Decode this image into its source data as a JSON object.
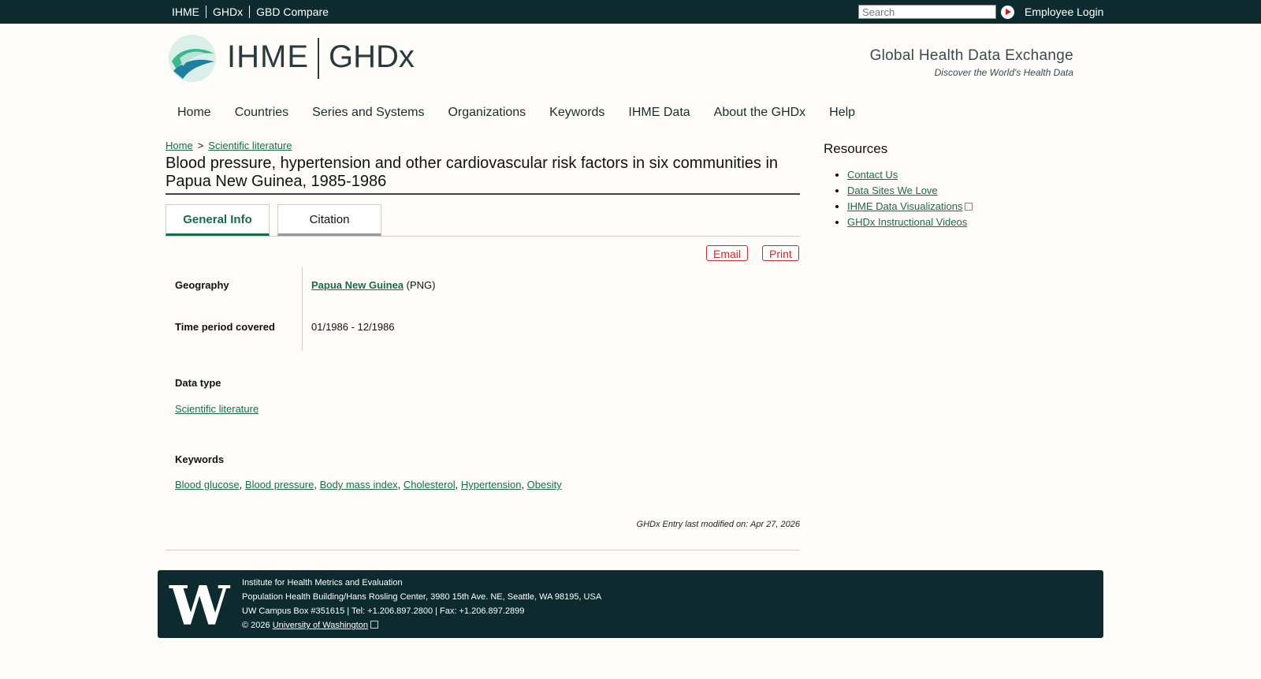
{
  "topbar": {
    "links": [
      "IHME",
      "GHDx",
      "GBD Compare"
    ],
    "search_placeholder": "Search",
    "employee_login": "Employee Login"
  },
  "header": {
    "logo_ihme": "IHME",
    "logo_ghdx": "GHDx",
    "tagline": "Global Health Data Exchange",
    "subtagline": "Discover the World's Health Data"
  },
  "nav": [
    "Home",
    "Countries",
    "Series and Systems",
    "Organizations",
    "Keywords",
    "IHME Data",
    "About the GHDx",
    "Help"
  ],
  "breadcrumb": {
    "home": "Home",
    "sep": ">",
    "current": "Scientific literature"
  },
  "title": "Blood pressure, hypertension and other cardiovascular risk factors in six communities in Papua New Guinea, 1985-1986",
  "tabs": {
    "general": "General Info",
    "citation": "Citation"
  },
  "actions": {
    "email": "Email",
    "print": "Print"
  },
  "fields": {
    "geography_label": "Geography",
    "geography_value": "Papua New Guinea",
    "geography_code": "(PNG)",
    "time_label": "Time period covered",
    "time_value": "01/1986 - 12/1986",
    "datatype_label": "Data type",
    "datatype_value": "Scientific literature",
    "keywords_label": "Keywords",
    "keywords": [
      "Blood glucose",
      "Blood pressure",
      "Body mass index",
      "Cholesterol",
      "Hypertension",
      "Obesity"
    ]
  },
  "modified": "GHDx Entry last modified on: Apr 27, 2026",
  "resources": {
    "title": "Resources",
    "items": [
      "Contact Us",
      "Data Sites We Love",
      "IHME Data Visualizations",
      "GHDx Instructional Videos"
    ]
  },
  "footer": {
    "logo": "W",
    "line1": "Institute for Health Metrics and Evaluation",
    "line2": "Population Health Building/Hans Rosling Center, 3980 15th Ave. NE, Seattle, WA 98195, USA",
    "line3": "UW Campus Box #351615 | Tel: +1.206.897.2800 | Fax: +1.206.897.2899",
    "copyright": "© 2026",
    "uw_link": "University of Washington"
  }
}
